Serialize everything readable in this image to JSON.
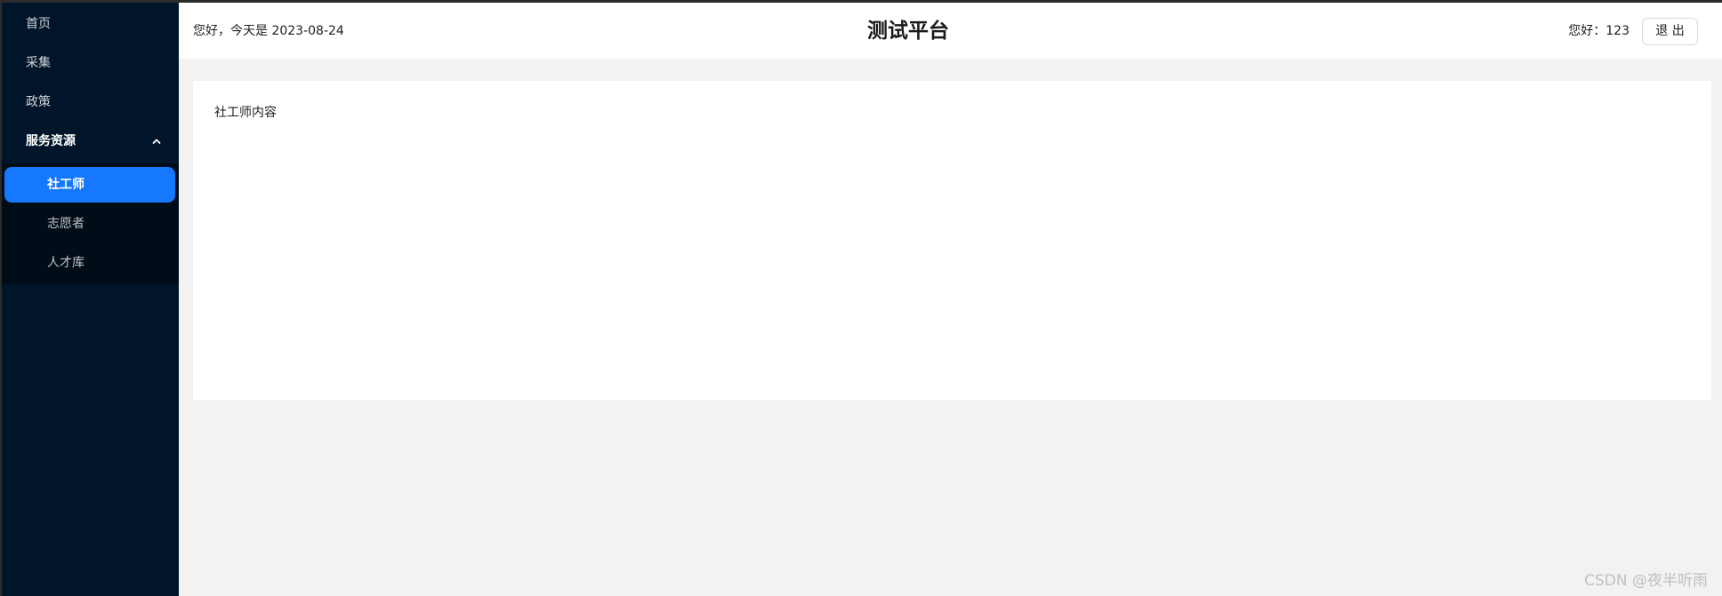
{
  "sidebar": {
    "items": [
      {
        "label": "首页"
      },
      {
        "label": "采集"
      },
      {
        "label": "政策"
      }
    ],
    "submenu": {
      "label": "服务资源",
      "icon": "chevron-up-icon",
      "children": [
        {
          "label": "社工师",
          "active": true
        },
        {
          "label": "志愿者",
          "active": false
        },
        {
          "label": "人才库",
          "active": false
        }
      ]
    }
  },
  "header": {
    "greeting": "您好，今天是 2023-08-24",
    "title": "测试平台",
    "user_hello": "您好：123",
    "logout_label": "退 出"
  },
  "main": {
    "content_text": "社工师内容"
  },
  "watermark": "CSDN @夜半听雨",
  "colors": {
    "sidebar_bg": "#001529",
    "submenu_bg": "#000c17",
    "active_item": "#1677ff",
    "page_bg": "#f2f2f2"
  }
}
